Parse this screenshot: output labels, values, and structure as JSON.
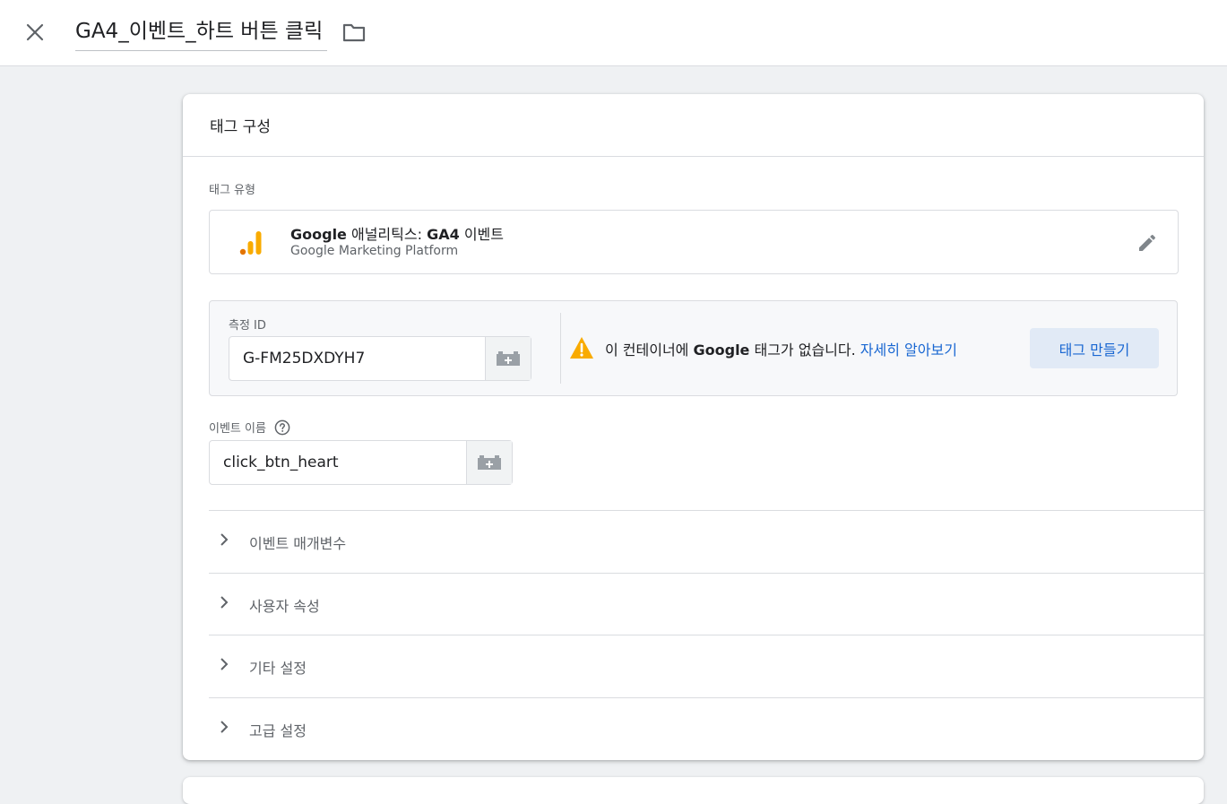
{
  "topbar": {
    "tag_name": "GA4_이벤트_하트 버튼 클릭",
    "close_icon": "close-icon",
    "folder_icon": "folder-icon"
  },
  "card": {
    "title": "태그 구성",
    "tag_type_label": "태그 유형",
    "tag_type": {
      "name_bold_1": "Google",
      "name_mid": " 애널리틱스: ",
      "name_bold_2": "GA4",
      "name_end": " 이벤트",
      "platform": "Google Marketing Platform",
      "icon": "google-analytics-icon"
    },
    "measurement": {
      "label": "측정 ID",
      "value": "G-FM25DXDYH7",
      "warning_pre": "이 컨테이너에 ",
      "warning_bold": "Google",
      "warning_post": " 태그가 없습니다. ",
      "learn_more": "자세히 알아보기",
      "create_button": "태그 만들기"
    },
    "event": {
      "label": "이벤트 이름",
      "value": "click_btn_heart"
    },
    "sections": [
      {
        "label": "이벤트 매개변수"
      },
      {
        "label": "사용자 속성"
      },
      {
        "label": "기타 설정"
      },
      {
        "label": "고급 설정"
      }
    ]
  },
  "colors": {
    "accent": "#1967d2",
    "warning": "#f9ab00",
    "ga_orange": "#e37400",
    "ga_yellow": "#f9ab00"
  }
}
